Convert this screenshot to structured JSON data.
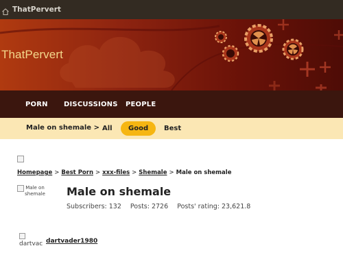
{
  "topbar": {
    "site_name": "ThatPervert",
    "home_icon": "home-icon"
  },
  "banner": {
    "logo": "ThatPervert"
  },
  "main_nav": {
    "items": [
      {
        "label": "PORN"
      },
      {
        "label": "DISCUSSIONS"
      },
      {
        "label": "PEOPLE"
      }
    ]
  },
  "sub_nav": {
    "current": "Male on shemale >",
    "filters": [
      {
        "label": "All",
        "active": false
      },
      {
        "label": "Good",
        "active": true
      },
      {
        "label": "Best",
        "active": false
      }
    ],
    "active_color": "#f6b612"
  },
  "breadcrumb": {
    "items": [
      "Homepage",
      "Best Porn",
      "xxx-files",
      "Shemale"
    ],
    "current": "Male on shemale"
  },
  "group": {
    "avatar_alt": "Male on shemale",
    "title": "Male on shemale",
    "subscribers": "Subscribers: 132",
    "posts": "Posts: 2726",
    "rating": "Posts' rating: 23,621.8"
  },
  "post": {
    "avatar_alt": "dartvac",
    "username": "dartvader1980"
  },
  "colors": {
    "topbar": "#332b22",
    "nav": "#3b160e",
    "subnav": "#fbe7b4",
    "logo": "#f3d88c"
  }
}
